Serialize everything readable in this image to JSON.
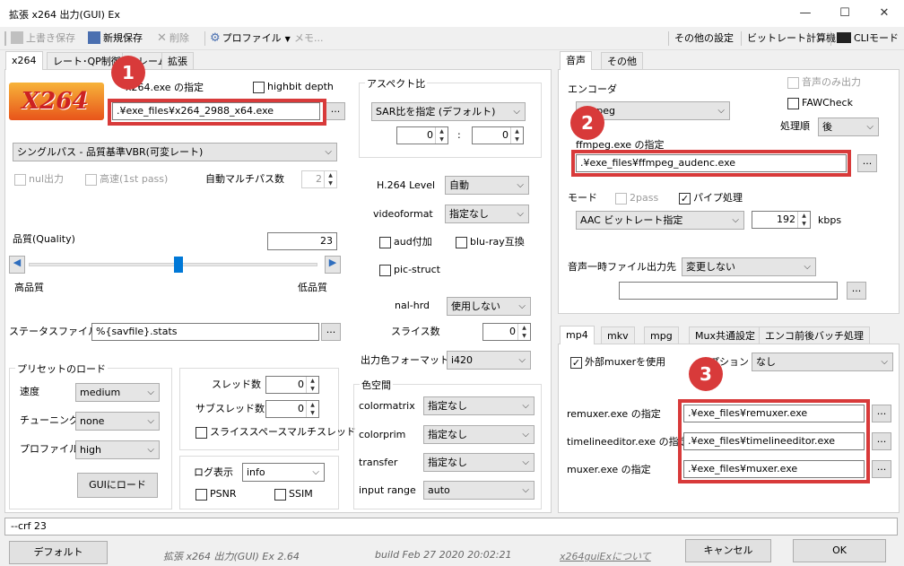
{
  "window": {
    "title": "拡張 x264 出力(GUI) Ex",
    "minimize_glyph": "—",
    "maximize_glyph": "☐",
    "close_glyph": "✕"
  },
  "toolbar": {
    "overwrite_save": "上書き保存",
    "new_save": "新規保存",
    "delete": "削除",
    "profile": "プロファイル",
    "memo": "メモ...",
    "other_settings": "その他の設定",
    "bitrate_calc": "ビットレート計算機",
    "cli_mode": "CLIモード"
  },
  "left_tabs": [
    "x264",
    "レート･QP制御",
    "フレーム",
    "拡張"
  ],
  "video": {
    "logo_text": "X264",
    "exe_label": "x264.exe の指定",
    "exe_path": ".¥exe_files¥x264_2988_x64.exe",
    "browse": "...",
    "highbit_label": "highbit depth",
    "mode_value": "シングルパス - 品質基準VBR(可変レート)",
    "nul_label": "nul出力",
    "fast_label": "高速(1st pass)",
    "auto_multipass_label": "自動マルチパス数",
    "auto_multipass_value": "2",
    "quality_label": "品質(Quality)",
    "quality_value": "23",
    "quality_slider_pct": 52,
    "high_quality": "高品質",
    "low_quality": "低品質",
    "status_file_label": "ステータスファイル",
    "status_file_value": "%{savfile}.stats"
  },
  "preset": {
    "title": "プリセットのロード",
    "speed_label": "速度",
    "speed_value": "medium",
    "tuning_label": "チューニング",
    "tuning_value": "none",
    "profile_label": "プロファイル",
    "profile_value": "high",
    "load_button": "GUIにロード"
  },
  "threads": {
    "threads_label": "スレッド数",
    "threads_value": "0",
    "subthreads_label": "サブスレッド数",
    "subthreads_value": "0",
    "slice_space_label": "スライススペースマルチスレッド"
  },
  "log": {
    "label": "ログ表示",
    "value": "info",
    "psnr": "PSNR",
    "ssim": "SSIM"
  },
  "aspect": {
    "title": "アスペクト比",
    "mode_value": "SAR比を指定 (デフォルト)",
    "x_value": "0",
    "colon": ":",
    "y_value": "0"
  },
  "h264": {
    "level_label": "H.264 Level",
    "level_value": "自動",
    "videoformat_label": "videoformat",
    "videoformat_value": "指定なし",
    "aud_label": "aud付加",
    "bluray_label": "blu-ray互換",
    "picstruct_label": "pic-struct",
    "nalhrd_label": "nal-hrd",
    "nalhrd_value": "使用しない",
    "slices_label": "スライス数",
    "slices_value": "0",
    "outcolor_label": "出力色フォーマット",
    "outcolor_value": "i420"
  },
  "colorspace": {
    "title": "色空間",
    "colormatrix_label": "colormatrix",
    "colormatrix_value": "指定なし",
    "colorprim_label": "colorprim",
    "colorprim_value": "指定なし",
    "transfer_label": "transfer",
    "transfer_value": "指定なし",
    "inputrange_label": "input range",
    "inputrange_value": "auto"
  },
  "audio_tabs": [
    "音声",
    "その他"
  ],
  "audio": {
    "encoder_label": "エンコーダ",
    "encoder_value": "ffmpeg",
    "audio_only_label": "音声のみ出力",
    "fawcheck_label": "FAWCheck",
    "order_label": "処理順",
    "order_value": "後",
    "exe_label": "ffmpeg.exe の指定",
    "exe_path": ".¥exe_files¥ffmpeg_audenc.exe",
    "mode_label": "モード",
    "twopass_label": "2pass",
    "pipe_label": "パイプ処理",
    "mode_value": "AAC ビットレート指定",
    "bitrate_value": "192",
    "kbps": "kbps",
    "temp_label": "音声一時ファイル出力先",
    "temp_value": "変更しない",
    "temp_path": ""
  },
  "mux_tabs": [
    "mp4",
    "mkv",
    "mpg",
    "Mux共通設定",
    "エンコ前後バッチ処理"
  ],
  "mux": {
    "external_muxer_label": "外部muxerを使用",
    "option_label": "オプション",
    "option_value": "なし",
    "remuxer_label": "remuxer.exe の指定",
    "remuxer_path": ".¥exe_files¥remuxer.exe",
    "timelineeditor_label": "timelineeditor.exe の指定",
    "timelineeditor_path": ".¥exe_files¥timelineeditor.exe",
    "muxer_label": "muxer.exe の指定",
    "muxer_path": ".¥exe_files¥muxer.exe"
  },
  "callouts": [
    "1",
    "2",
    "3"
  ],
  "status_line": "--crf 23",
  "footer": {
    "default_button": "デフォルト",
    "app_version": "拡張 x264 出力(GUI) Ex 2.64",
    "build": "build Feb 27 2020 20:02:21",
    "about_link": "x264guiExについて",
    "cancel_button": "キャンセル",
    "ok_button": "OK"
  },
  "colors": {
    "accent_red": "#d83a3a",
    "logo_bg": "#e8541a"
  }
}
